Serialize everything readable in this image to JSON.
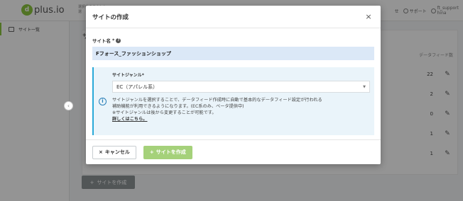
{
  "app": {
    "logo_text": "plus.io",
    "logo_mark": "d",
    "tenant_line1": "選択中のテナント",
    "tenant_line2": "選",
    "nav_help": "せ",
    "nav_support": "サポート",
    "user_line1": "ft_support",
    "user_line2": "hina"
  },
  "sidebar": {
    "items": [
      {
        "label": "サイト一覧",
        "icon": "copy-icon"
      }
    ],
    "collapse_glyph": "‹"
  },
  "background_page": {
    "title": "サ",
    "column_header": "データフィード数",
    "rows": [
      {
        "count": "22"
      },
      {
        "count": "2"
      },
      {
        "count": "0"
      },
      {
        "count": "1"
      },
      {
        "count": "1"
      }
    ],
    "add_button_label": "サイトを作成",
    "add_button_icon": "+"
  },
  "modal": {
    "title": "サイトの作成",
    "close_glyph": "×",
    "site_name_label": "サイト名",
    "required_mark": "*",
    "help_glyph": "?",
    "site_name_value": "Fフォース_ファッションショップ",
    "genre_label": "サイトジャンル*",
    "genre_selected": "EC（アパレル系）",
    "info_glyph": "i",
    "info_line1": "サイトジャンルを選択することで、データフィード作成時に自動で基本的なデータフィード設定が行われる",
    "info_line2": "補助機能が利用できるようになります。(EC系のみ、ベータ提供中)",
    "info_line3": "※サイトジャンルは後から変更することが可能です。",
    "info_link": "詳しくはこちら。",
    "cancel_icon": "×",
    "cancel_label": "キャンセル",
    "create_icon": "+",
    "create_label": "サイトを作成"
  },
  "colors": {
    "brand_green": "#8cc63f",
    "create_button": "#a5d17a",
    "info_accent": "#2aa9d8",
    "input_bg": "#dbe8f7"
  }
}
